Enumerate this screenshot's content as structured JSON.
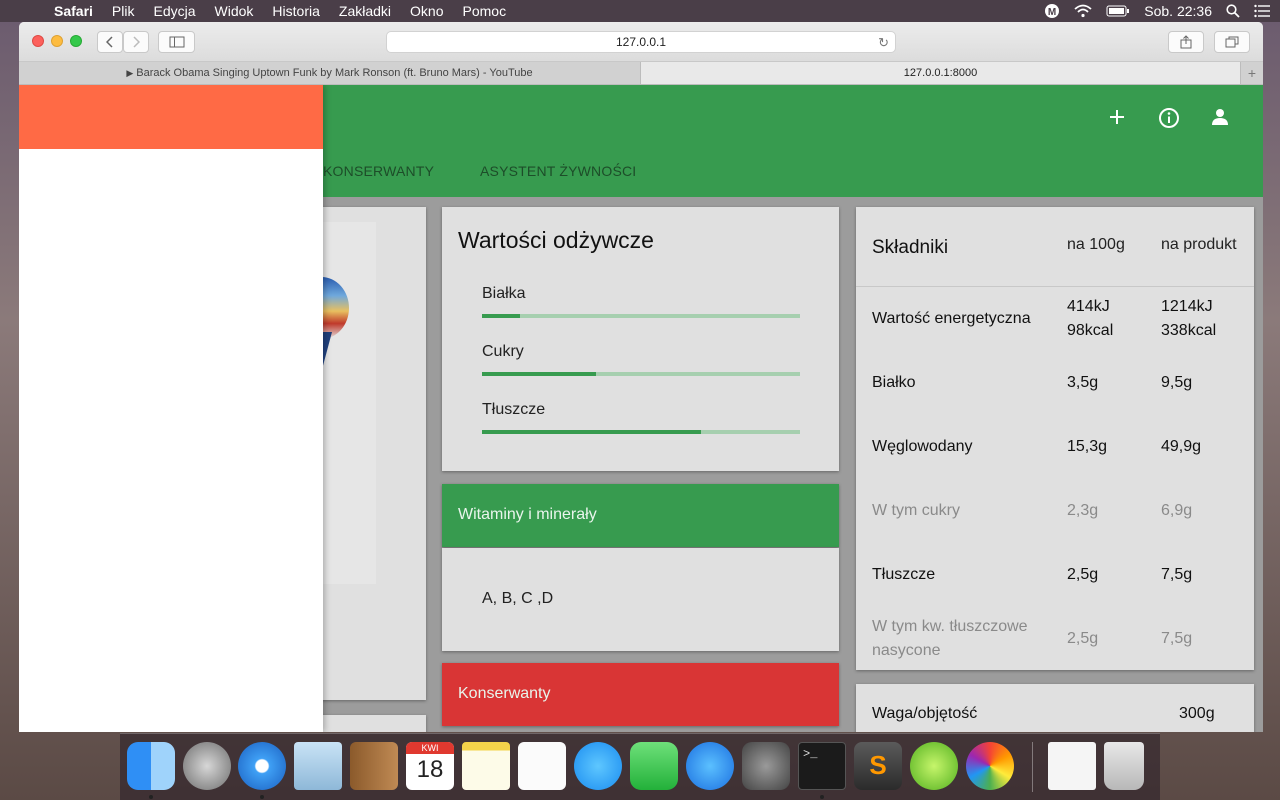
{
  "menubar": {
    "app": "Safari",
    "items": [
      "Plik",
      "Edycja",
      "Widok",
      "Historia",
      "Zakładki",
      "Okno",
      "Pomoc"
    ],
    "clock": "Sob. 22:36"
  },
  "browser": {
    "url": "127.0.0.1",
    "tabs": [
      {
        "label": "Barack Obama Singing Uptown Funk by Mark Ronson (ft. Bruno Mars) - YouTube",
        "active": false
      },
      {
        "label": "127.0.0.1:8000",
        "active": true
      }
    ]
  },
  "app": {
    "nav_tabs": [
      "KONSERWANTY",
      "ASYSTENT ŻYWNOŚCI"
    ],
    "colors": {
      "primary": "#379b4f",
      "drawer_header": "#ff6a45",
      "danger": "#d93535"
    },
    "header_icons": [
      "add-icon",
      "info-icon",
      "account-icon"
    ]
  },
  "nutrition": {
    "title": "Wartości odżywcze",
    "rows": [
      {
        "label": "Białka",
        "fraction": 0.12
      },
      {
        "label": "Cukry",
        "fraction": 0.36
      },
      {
        "label": "Tłuszcze",
        "fraction": 0.69
      }
    ]
  },
  "vitamins": {
    "title": "Witaminy i minerały",
    "content": "A, B, C ,D"
  },
  "preservatives": {
    "title": "Konserwanty"
  },
  "ingredients": {
    "header": {
      "name": "Składniki",
      "per100": "na 100g",
      "perProduct": "na produkt"
    },
    "rows": [
      {
        "name": "Wartość energetyczna",
        "per100": "414kJ",
        "per100b": "98kcal",
        "perProduct": "1214kJ",
        "perProductb": "338kcal",
        "sub": false
      },
      {
        "name": "Białko",
        "per100": "3,5g",
        "per100b": "",
        "perProduct": "9,5g",
        "perProductb": "",
        "sub": false
      },
      {
        "name": "Węglowodany",
        "per100": "15,3g",
        "per100b": "",
        "perProduct": "49,9g",
        "perProductb": "",
        "sub": false
      },
      {
        "name": "W tym cukry",
        "per100": "2,3g",
        "per100b": "",
        "perProduct": "6,9g",
        "perProductb": "",
        "sub": true
      },
      {
        "name": "Tłuszcze",
        "per100": "2,5g",
        "per100b": "",
        "perProduct": "7,5g",
        "perProductb": "",
        "sub": false
      },
      {
        "name": "W tym kw. tłuszczowe nasycone",
        "per100": "2,5g",
        "per100b": "",
        "perProduct": "7,5g",
        "perProductb": "",
        "sub": true
      }
    ]
  },
  "weight": {
    "label": "Waga/objętość",
    "value": "300g"
  },
  "dock": {
    "calendar_month": "KWI",
    "calendar_day": "18"
  }
}
